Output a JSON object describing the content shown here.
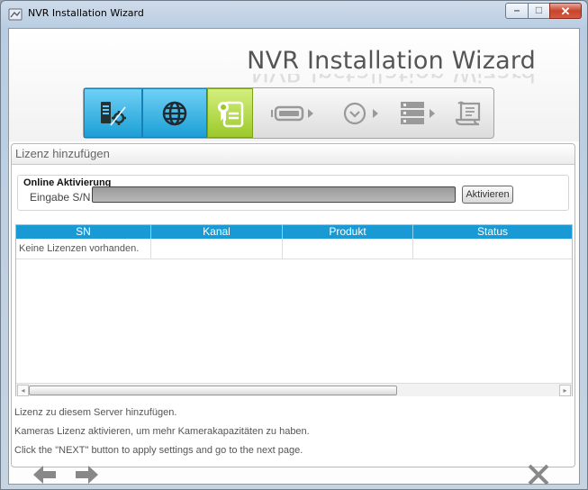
{
  "window": {
    "title": "NVR Installation Wizard",
    "controls": {
      "minimize": "–",
      "maximize": "□",
      "close": "✕"
    }
  },
  "wizard": {
    "title": "NVR Installation Wizard",
    "steps": [
      {
        "icon": "server-settings-icon",
        "state": "done"
      },
      {
        "icon": "globe-icon",
        "state": "done"
      },
      {
        "icon": "license-certificate-icon",
        "state": "active"
      },
      {
        "icon": "storage-device-icon",
        "state": "pending"
      },
      {
        "icon": "clock-icon",
        "state": "pending"
      },
      {
        "icon": "server-stack-icon",
        "state": "pending"
      },
      {
        "icon": "scroll-finish-icon",
        "state": "pending"
      }
    ]
  },
  "panel": {
    "title": "Lizenz hinzufügen",
    "online": {
      "title": "Online Aktivierung",
      "sn_label": "Eingabe S/N",
      "sn_value": "",
      "activate_label": "Aktivieren"
    },
    "table": {
      "columns": [
        "SN",
        "Kanal",
        "Produkt",
        "Status"
      ],
      "rows": [
        [
          "Keine Lizenzen vorhanden.",
          "",
          "",
          ""
        ]
      ]
    }
  },
  "info": [
    "Lizenz zu diesem Server hinzufügen.",
    "Kameras Lizenz aktivieren, um mehr Kamerakapazitäten zu haben.",
    "Click the \"NEXT\" button to apply settings and go to the next page."
  ],
  "nav": {
    "back_icon": "arrow-left-icon",
    "next_icon": "arrow-right-icon",
    "cancel_icon": "close-x-icon"
  },
  "colors": {
    "accent_blue": "#1a9ad4",
    "active_green": "#9cc92a",
    "title_gray": "#555555"
  }
}
